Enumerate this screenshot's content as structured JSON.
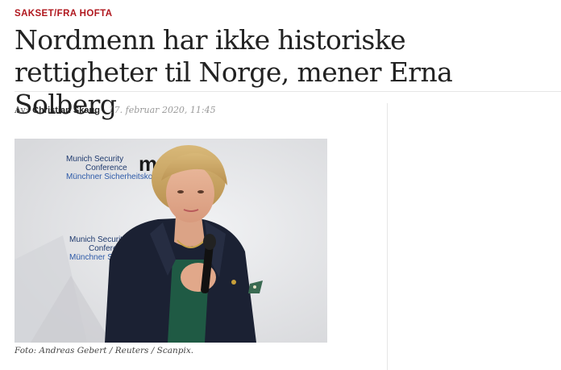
{
  "article": {
    "kicker": "SAKSET/FRA HOFTA",
    "headline": "Nordmenn har ikke historiske rettigheter til Norge, mener Erna Solberg",
    "byline_prefix": "Av:",
    "author": "Christian Skaug",
    "date": "17. februar 2020, 11:45",
    "photo": {
      "backdrop_line1": "Munich Security",
      "backdrop_line2": "Conference",
      "backdrop_line3": "Münchner Sicherheitskon",
      "backdrop_logo": "msc",
      "backdrop_lower_line1": "Munich Security",
      "backdrop_lower_line2": "Conferenc",
      "backdrop_lower_line3": "Münchner Si"
    },
    "caption": "Foto: Andreas Gebert / Reuters / Scanpix."
  },
  "colors": {
    "kicker": "#b0171e",
    "headline": "#222222",
    "backdrop_text": "#1f3a6e"
  }
}
